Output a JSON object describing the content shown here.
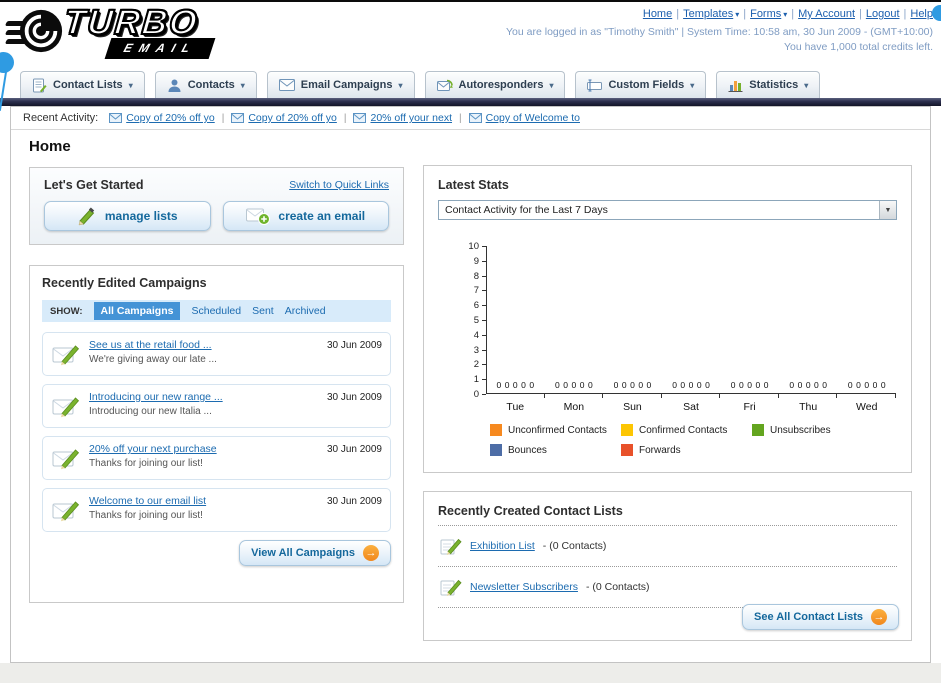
{
  "page": {
    "title": "Home"
  },
  "header": {
    "logo_line1": "TURBO",
    "logo_line2": "EMAIL",
    "links": [
      {
        "label": "Home"
      },
      {
        "label": "Templates"
      },
      {
        "label": "Forms"
      },
      {
        "label": "My Account"
      },
      {
        "label": "Logout"
      },
      {
        "label": "Help"
      }
    ],
    "session_line": "You are logged in as \"Timothy Smith\" | System Time: 10:58 am, 30 Jun 2009 - (GMT+10:00)",
    "credits_line": "You have 1,000 total credits left."
  },
  "nav": {
    "tabs": [
      {
        "label": "Contact Lists",
        "icon": "contact-lists-icon"
      },
      {
        "label": "Contacts",
        "icon": "contacts-icon"
      },
      {
        "label": "Email Campaigns",
        "icon": "email-campaigns-icon"
      },
      {
        "label": "Autoresponders",
        "icon": "autoresponders-icon"
      },
      {
        "label": "Custom Fields",
        "icon": "custom-fields-icon"
      },
      {
        "label": "Statistics",
        "icon": "statistics-icon"
      }
    ]
  },
  "recent_activity": {
    "label": "Recent Activity:",
    "items": [
      "Copy of 20% off yo",
      "Copy of 20% off yo",
      "20% off your next",
      "Copy of Welcome to"
    ]
  },
  "get_started": {
    "title": "Let's Get Started",
    "switch_link": "Switch to Quick Links",
    "manage_lists_label": "manage lists",
    "create_email_label": "create an email"
  },
  "campaigns": {
    "title": "Recently Edited Campaigns",
    "show_label": "SHOW:",
    "filters": [
      "All Campaigns",
      "Scheduled",
      "Sent",
      "Archived"
    ],
    "active_filter": "All Campaigns",
    "items": [
      {
        "title": "See us at the retail food ...",
        "subtitle": "We're giving away our late ...",
        "date": "30 Jun 2009"
      },
      {
        "title": "Introducing our new range ...",
        "subtitle": "Introducing our new Italia ...",
        "date": "30 Jun 2009"
      },
      {
        "title": "20% off your next purchase",
        "subtitle": "Thanks for joining our list!",
        "date": "30 Jun 2009"
      },
      {
        "title": "Welcome to our email list",
        "subtitle": "Thanks for joining our list!",
        "date": "30 Jun 2009"
      }
    ],
    "view_all_label": "View All Campaigns"
  },
  "stats": {
    "title": "Latest Stats",
    "selector_value": "Contact Activity for the Last 7 Days"
  },
  "chart_data": {
    "type": "bar",
    "title": "Contact Activity for the Last 7 Days",
    "categories": [
      "Tue",
      "Mon",
      "Sun",
      "Sat",
      "Fri",
      "Thu",
      "Wed"
    ],
    "series": [
      {
        "name": "Unconfirmed Contacts",
        "color": "#f6891f",
        "values": [
          0,
          0,
          0,
          0,
          0,
          0,
          0
        ]
      },
      {
        "name": "Confirmed Contacts",
        "color": "#fdc603",
        "values": [
          0,
          0,
          0,
          0,
          0,
          0,
          0
        ]
      },
      {
        "name": "Unsubscribes",
        "color": "#63a51f",
        "values": [
          0,
          0,
          0,
          0,
          0,
          0,
          0
        ]
      },
      {
        "name": "Bounces",
        "color": "#4d6da6",
        "values": [
          0,
          0,
          0,
          0,
          0,
          0,
          0
        ]
      },
      {
        "name": "Forwards",
        "color": "#e8512a",
        "values": [
          0,
          0,
          0,
          0,
          0,
          0,
          0
        ]
      }
    ],
    "ylim": [
      0,
      10
    ],
    "ytick_step": 1,
    "grid": false,
    "legend_position": "bottom"
  },
  "contact_lists": {
    "title": "Recently Created Contact Lists",
    "items": [
      {
        "name": "Exhibition List",
        "count": "- (0 Contacts)"
      },
      {
        "name": "Newsletter Subscribers",
        "count": "- (0 Contacts)"
      }
    ],
    "see_all_label": "See All Contact Lists"
  }
}
